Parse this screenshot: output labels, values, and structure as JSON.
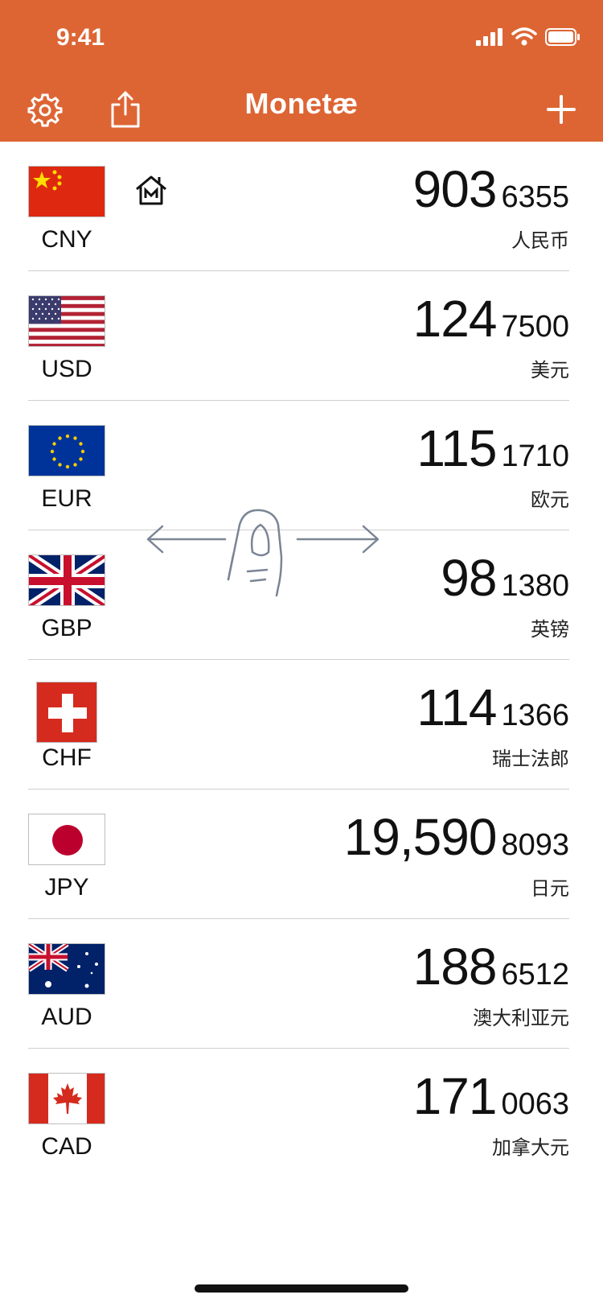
{
  "status_bar": {
    "time": "9:41"
  },
  "header": {
    "title": "Monetæ"
  },
  "rates": [
    {
      "code": "CNY",
      "integer": "903",
      "decimal": "6355",
      "name": "人民币",
      "base": true
    },
    {
      "code": "USD",
      "integer": "124",
      "decimal": "7500",
      "name": "美元"
    },
    {
      "code": "EUR",
      "integer": "115",
      "decimal": "1710",
      "name": "欧元"
    },
    {
      "code": "GBP",
      "integer": "98",
      "decimal": "1380",
      "name": "英镑"
    },
    {
      "code": "CHF",
      "integer": "114",
      "decimal": "1366",
      "name": "瑞士法郎"
    },
    {
      "code": "JPY",
      "integer": "19,590",
      "decimal": "8093",
      "name": "日元"
    },
    {
      "code": "AUD",
      "integer": "188",
      "decimal": "6512",
      "name": "澳大利亚元"
    },
    {
      "code": "CAD",
      "integer": "171",
      "decimal": "0063",
      "name": "加拿大元"
    }
  ],
  "colors": {
    "accent": "#DD6534"
  }
}
